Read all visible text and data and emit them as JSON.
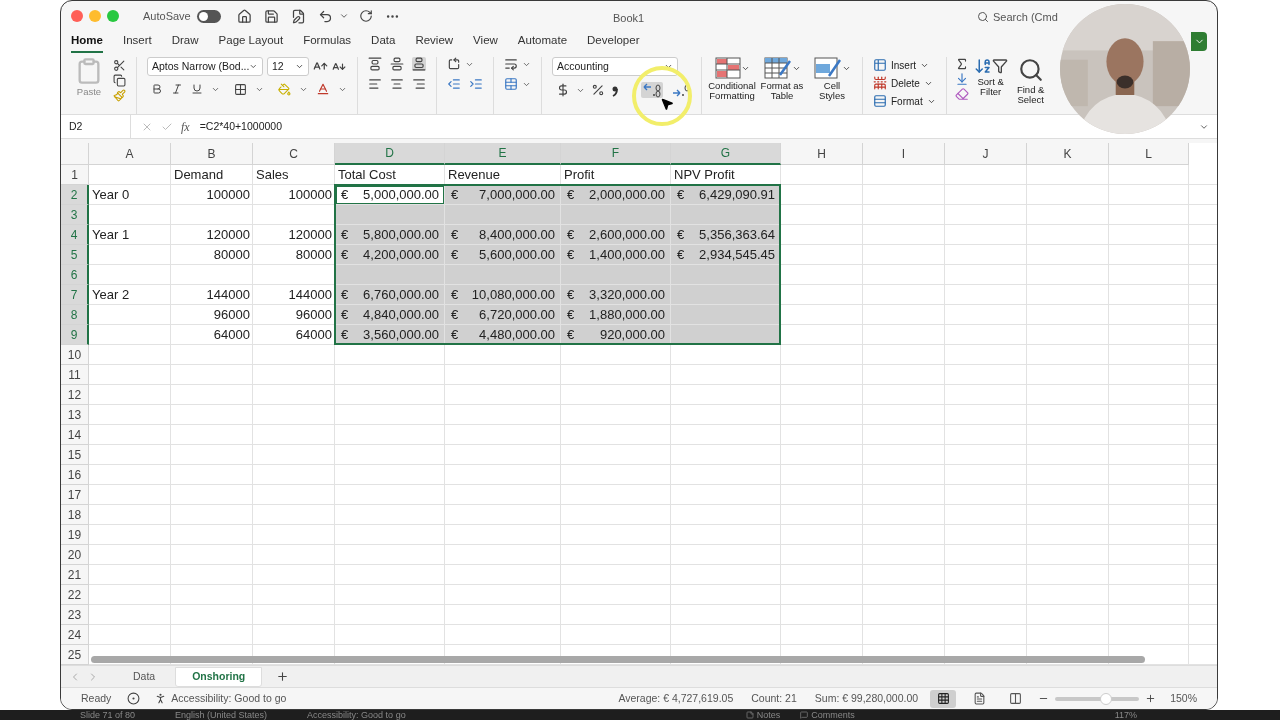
{
  "window": {
    "title": "Book1",
    "autosave_label": "AutoSave",
    "autosave_on": false,
    "search_placeholder": "Search (Cmd"
  },
  "tabs": [
    {
      "label": "Home",
      "selected": true
    },
    {
      "label": "Insert",
      "selected": false
    },
    {
      "label": "Draw",
      "selected": false
    },
    {
      "label": "Page Layout",
      "selected": false
    },
    {
      "label": "Formulas",
      "selected": false
    },
    {
      "label": "Data",
      "selected": false
    },
    {
      "label": "Review",
      "selected": false
    },
    {
      "label": "View",
      "selected": false
    },
    {
      "label": "Automate",
      "selected": false
    },
    {
      "label": "Developer",
      "selected": false
    }
  ],
  "ribbon": {
    "paste_label": "Paste",
    "font_name": "Aptos Narrow (Bod...",
    "font_size": "12",
    "number_format": "Accounting",
    "style_buttons": [
      {
        "label": "Conditional Formatting",
        "kind": "conditional"
      },
      {
        "label": "Format as Table",
        "kind": "table"
      },
      {
        "label": "Cell Styles",
        "kind": "styles"
      }
    ],
    "cells_buttons": [
      {
        "label": "Insert",
        "kind": "insert"
      },
      {
        "label": "Delete",
        "kind": "delete"
      },
      {
        "label": "Format",
        "kind": "format"
      }
    ],
    "editing_buttons": [
      {
        "label": "Sort & Filter",
        "kind": "sort"
      },
      {
        "label": "Find & Select",
        "kind": "find"
      }
    ]
  },
  "formula_bar": {
    "name_box": "D2",
    "fx_label": "fx",
    "formula": "=C2*40+1000000"
  },
  "sheet": {
    "columns": [
      {
        "label": "A",
        "selected": false
      },
      {
        "label": "B",
        "selected": false
      },
      {
        "label": "C",
        "selected": false
      },
      {
        "label": "D",
        "selected": true
      },
      {
        "label": "E",
        "selected": true
      },
      {
        "label": "F",
        "selected": true
      },
      {
        "label": "G",
        "selected": true
      },
      {
        "label": "H",
        "selected": false
      },
      {
        "label": "I",
        "selected": false
      },
      {
        "label": "J",
        "selected": false
      },
      {
        "label": "K",
        "selected": false
      },
      {
        "label": "L",
        "selected": false
      }
    ],
    "rows": [
      {
        "label": "1",
        "selected": false,
        "cells": [
          null,
          {
            "kind": "text",
            "text": "Demand",
            "active": false
          },
          {
            "kind": "text",
            "text": "Sales",
            "active": false
          },
          {
            "kind": "text",
            "text": "Total Cost",
            "active": false
          },
          {
            "kind": "text",
            "text": "Revenue",
            "active": false
          },
          {
            "kind": "text",
            "text": "Profit",
            "active": false
          },
          {
            "kind": "text",
            "text": "NPV Profit",
            "active": false
          }
        ]
      },
      {
        "label": "2",
        "selected": true,
        "cells": [
          {
            "kind": "text",
            "text": "Year 0",
            "active": false
          },
          {
            "kind": "number",
            "text": "100000",
            "active": false
          },
          {
            "kind": "number",
            "text": "100000",
            "active": false
          },
          {
            "kind": "accounting",
            "symbol": "€",
            "text": "5,000,000.00",
            "active": true
          },
          {
            "kind": "accounting",
            "symbol": "€",
            "text": "7,000,000.00",
            "active": false
          },
          {
            "kind": "accounting",
            "symbol": "€",
            "text": "2,000,000.00",
            "active": false
          },
          {
            "kind": "accounting",
            "symbol": "€",
            "text": "6,429,090.91",
            "active": false
          }
        ]
      },
      {
        "label": "3",
        "selected": true,
        "cells": []
      },
      {
        "label": "4",
        "selected": true,
        "cells": [
          {
            "kind": "text",
            "text": "Year 1",
            "active": false
          },
          {
            "kind": "number",
            "text": "120000",
            "active": false
          },
          {
            "kind": "number",
            "text": "120000",
            "active": false
          },
          {
            "kind": "accounting",
            "symbol": "€",
            "text": "5,800,000.00",
            "active": false
          },
          {
            "kind": "accounting",
            "symbol": "€",
            "text": "8,400,000.00",
            "active": false
          },
          {
            "kind": "accounting",
            "symbol": "€",
            "text": "2,600,000.00",
            "active": false
          },
          {
            "kind": "accounting",
            "symbol": "€",
            "text": "5,356,363.64",
            "active": false
          }
        ]
      },
      {
        "label": "5",
        "selected": true,
        "cells": [
          null,
          {
            "kind": "number",
            "text": "80000",
            "active": false
          },
          {
            "kind": "number",
            "text": "80000",
            "active": false
          },
          {
            "kind": "accounting",
            "symbol": "€",
            "text": "4,200,000.00",
            "active": false
          },
          {
            "kind": "accounting",
            "symbol": "€",
            "text": "5,600,000.00",
            "active": false
          },
          {
            "kind": "accounting",
            "symbol": "€",
            "text": "1,400,000.00",
            "active": false
          },
          {
            "kind": "accounting",
            "symbol": "€",
            "text": "2,934,545.45",
            "active": false
          }
        ]
      },
      {
        "label": "6",
        "selected": true,
        "cells": []
      },
      {
        "label": "7",
        "selected": true,
        "cells": [
          {
            "kind": "text",
            "text": "Year 2",
            "active": false
          },
          {
            "kind": "number",
            "text": "144000",
            "active": false
          },
          {
            "kind": "number",
            "text": "144000",
            "active": false
          },
          {
            "kind": "accounting",
            "symbol": "€",
            "text": "6,760,000.00",
            "active": false
          },
          {
            "kind": "accounting",
            "symbol": "€",
            "text": "10,080,000.00",
            "active": false
          },
          {
            "kind": "accounting",
            "symbol": "€",
            "text": "3,320,000.00",
            "active": false
          }
        ]
      },
      {
        "label": "8",
        "selected": true,
        "cells": [
          null,
          {
            "kind": "number",
            "text": "96000",
            "active": false
          },
          {
            "kind": "number",
            "text": "96000",
            "active": false
          },
          {
            "kind": "accounting",
            "symbol": "€",
            "text": "4,840,000.00",
            "active": false
          },
          {
            "kind": "accounting",
            "symbol": "€",
            "text": "6,720,000.00",
            "active": false
          },
          {
            "kind": "accounting",
            "symbol": "€",
            "text": "1,880,000.00",
            "active": false
          }
        ]
      },
      {
        "label": "9",
        "selected": true,
        "cells": [
          null,
          {
            "kind": "number",
            "text": "64000",
            "active": false
          },
          {
            "kind": "number",
            "text": "64000",
            "active": false
          },
          {
            "kind": "accounting",
            "symbol": "€",
            "text": "3,560,000.00",
            "active": false
          },
          {
            "kind": "accounting",
            "symbol": "€",
            "text": "4,480,000.00",
            "active": false
          },
          {
            "kind": "accounting",
            "symbol": "€",
            "text": "920,000.00",
            "active": false
          }
        ]
      },
      {
        "label": "10",
        "selected": false,
        "cells": []
      },
      {
        "label": "11",
        "selected": false,
        "cells": []
      },
      {
        "label": "12",
        "selected": false,
        "cells": []
      },
      {
        "label": "13",
        "selected": false,
        "cells": []
      },
      {
        "label": "14",
        "selected": false,
        "cells": []
      },
      {
        "label": "15",
        "selected": false,
        "cells": []
      },
      {
        "label": "16",
        "selected": false,
        "cells": []
      },
      {
        "label": "17",
        "selected": false,
        "cells": []
      },
      {
        "label": "18",
        "selected": false,
        "cells": []
      },
      {
        "label": "19",
        "selected": false,
        "cells": []
      },
      {
        "label": "20",
        "selected": false,
        "cells": []
      },
      {
        "label": "21",
        "selected": false,
        "cells": []
      },
      {
        "label": "22",
        "selected": false,
        "cells": []
      },
      {
        "label": "23",
        "selected": false,
        "cells": []
      },
      {
        "label": "24",
        "selected": false,
        "cells": []
      },
      {
        "label": "25",
        "selected": false,
        "cells": []
      }
    ]
  },
  "sheet_tabs": [
    {
      "label": "Data",
      "selected": false
    },
    {
      "label": "Onshoring",
      "selected": true
    }
  ],
  "status_bar": {
    "ready": "Ready",
    "accessibility": "Accessibility: Good to go",
    "average": "Average:  € 4,727,619.05",
    "count": "Count: 21",
    "sum": "Sum:  € 99,280,000.00",
    "views": [
      {
        "kind": "normal",
        "selected": true
      },
      {
        "kind": "page",
        "selected": false
      },
      {
        "kind": "break",
        "selected": false
      }
    ],
    "zoom": {
      "level": 0.6,
      "reading": "150%"
    }
  },
  "background_status": {
    "slide": "Slide 71 of 80",
    "language": "English (United States)",
    "accessibility": "Accessibility: Good to go",
    "notes": "Notes",
    "comments": "Comments",
    "zoom": "117%"
  }
}
